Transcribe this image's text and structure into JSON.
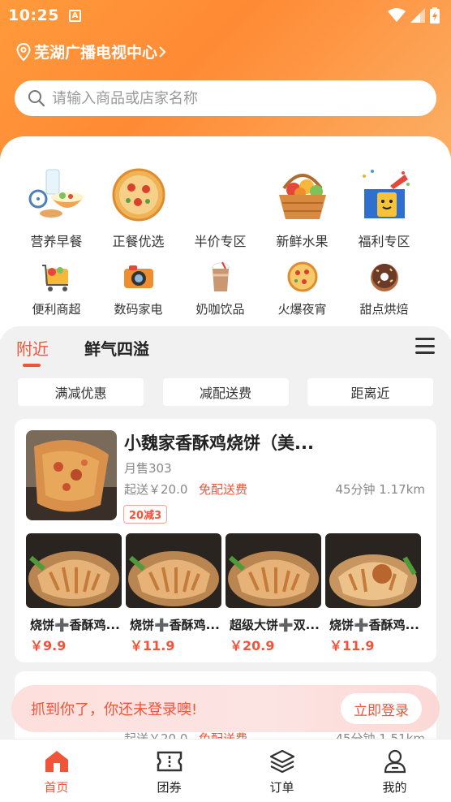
{
  "status_bar": {
    "time": "10:25",
    "notification_glyph": "A"
  },
  "header": {
    "location": "芜湖广播电视中心",
    "search_placeholder": "请输入商品或店家名称"
  },
  "categories_row1": [
    {
      "label": "营养早餐",
      "icon": "breakfast-icon"
    },
    {
      "label": "正餐优选",
      "icon": "meal-plate-icon"
    },
    {
      "label": "半价专区",
      "icon": "half-price-icon"
    },
    {
      "label": "新鲜水果",
      "icon": "fruit-basket-icon"
    },
    {
      "label": "福利专区",
      "icon": "gift-box-icon"
    }
  ],
  "categories_row2": [
    {
      "label": "便利商超",
      "icon": "shopping-cart-icon"
    },
    {
      "label": "数码家电",
      "icon": "camera-icon"
    },
    {
      "label": "奶咖饮品",
      "icon": "milk-tea-icon"
    },
    {
      "label": "火爆夜宵",
      "icon": "pizza-icon"
    },
    {
      "label": "甜点烘焙",
      "icon": "donut-icon"
    }
  ],
  "tabs": [
    {
      "label": "附近",
      "active": true
    },
    {
      "label": "鲜气四溢",
      "active": false
    }
  ],
  "filters": [
    "满减优惠",
    "减配送费",
    "距离近"
  ],
  "shop": {
    "name": "小魏家香酥鸡烧饼（美...",
    "sales": "月售303",
    "min_order": "起送￥20.0",
    "free_delivery": "免配送费",
    "time_distance": "45分钟  1.17km",
    "badge": "20减3",
    "products": [
      {
        "name": "烧饼➕香酥鸡...",
        "price": "￥9.9"
      },
      {
        "name": "烧饼➕香酥鸡...",
        "price": "￥11.9"
      },
      {
        "name": "超级大饼➕双...",
        "price": "￥20.9"
      },
      {
        "name": "烧饼➕香酥鸡...",
        "price": "￥11.9"
      }
    ]
  },
  "shop2": {
    "min_order": "起送￥20.0",
    "free_delivery": "免配送费",
    "time_distance": "45分钟  1.51km"
  },
  "login_banner": {
    "text": "抓到你了，你还未登录噢!",
    "button": "立即登录"
  },
  "bottom_nav": [
    {
      "label": "首页",
      "active": true
    },
    {
      "label": "团券",
      "active": false
    },
    {
      "label": "订单",
      "active": false
    },
    {
      "label": "我的",
      "active": false
    }
  ],
  "colors": {
    "brand_orange": "#ff8a34",
    "accent_red": "#f2543a"
  }
}
